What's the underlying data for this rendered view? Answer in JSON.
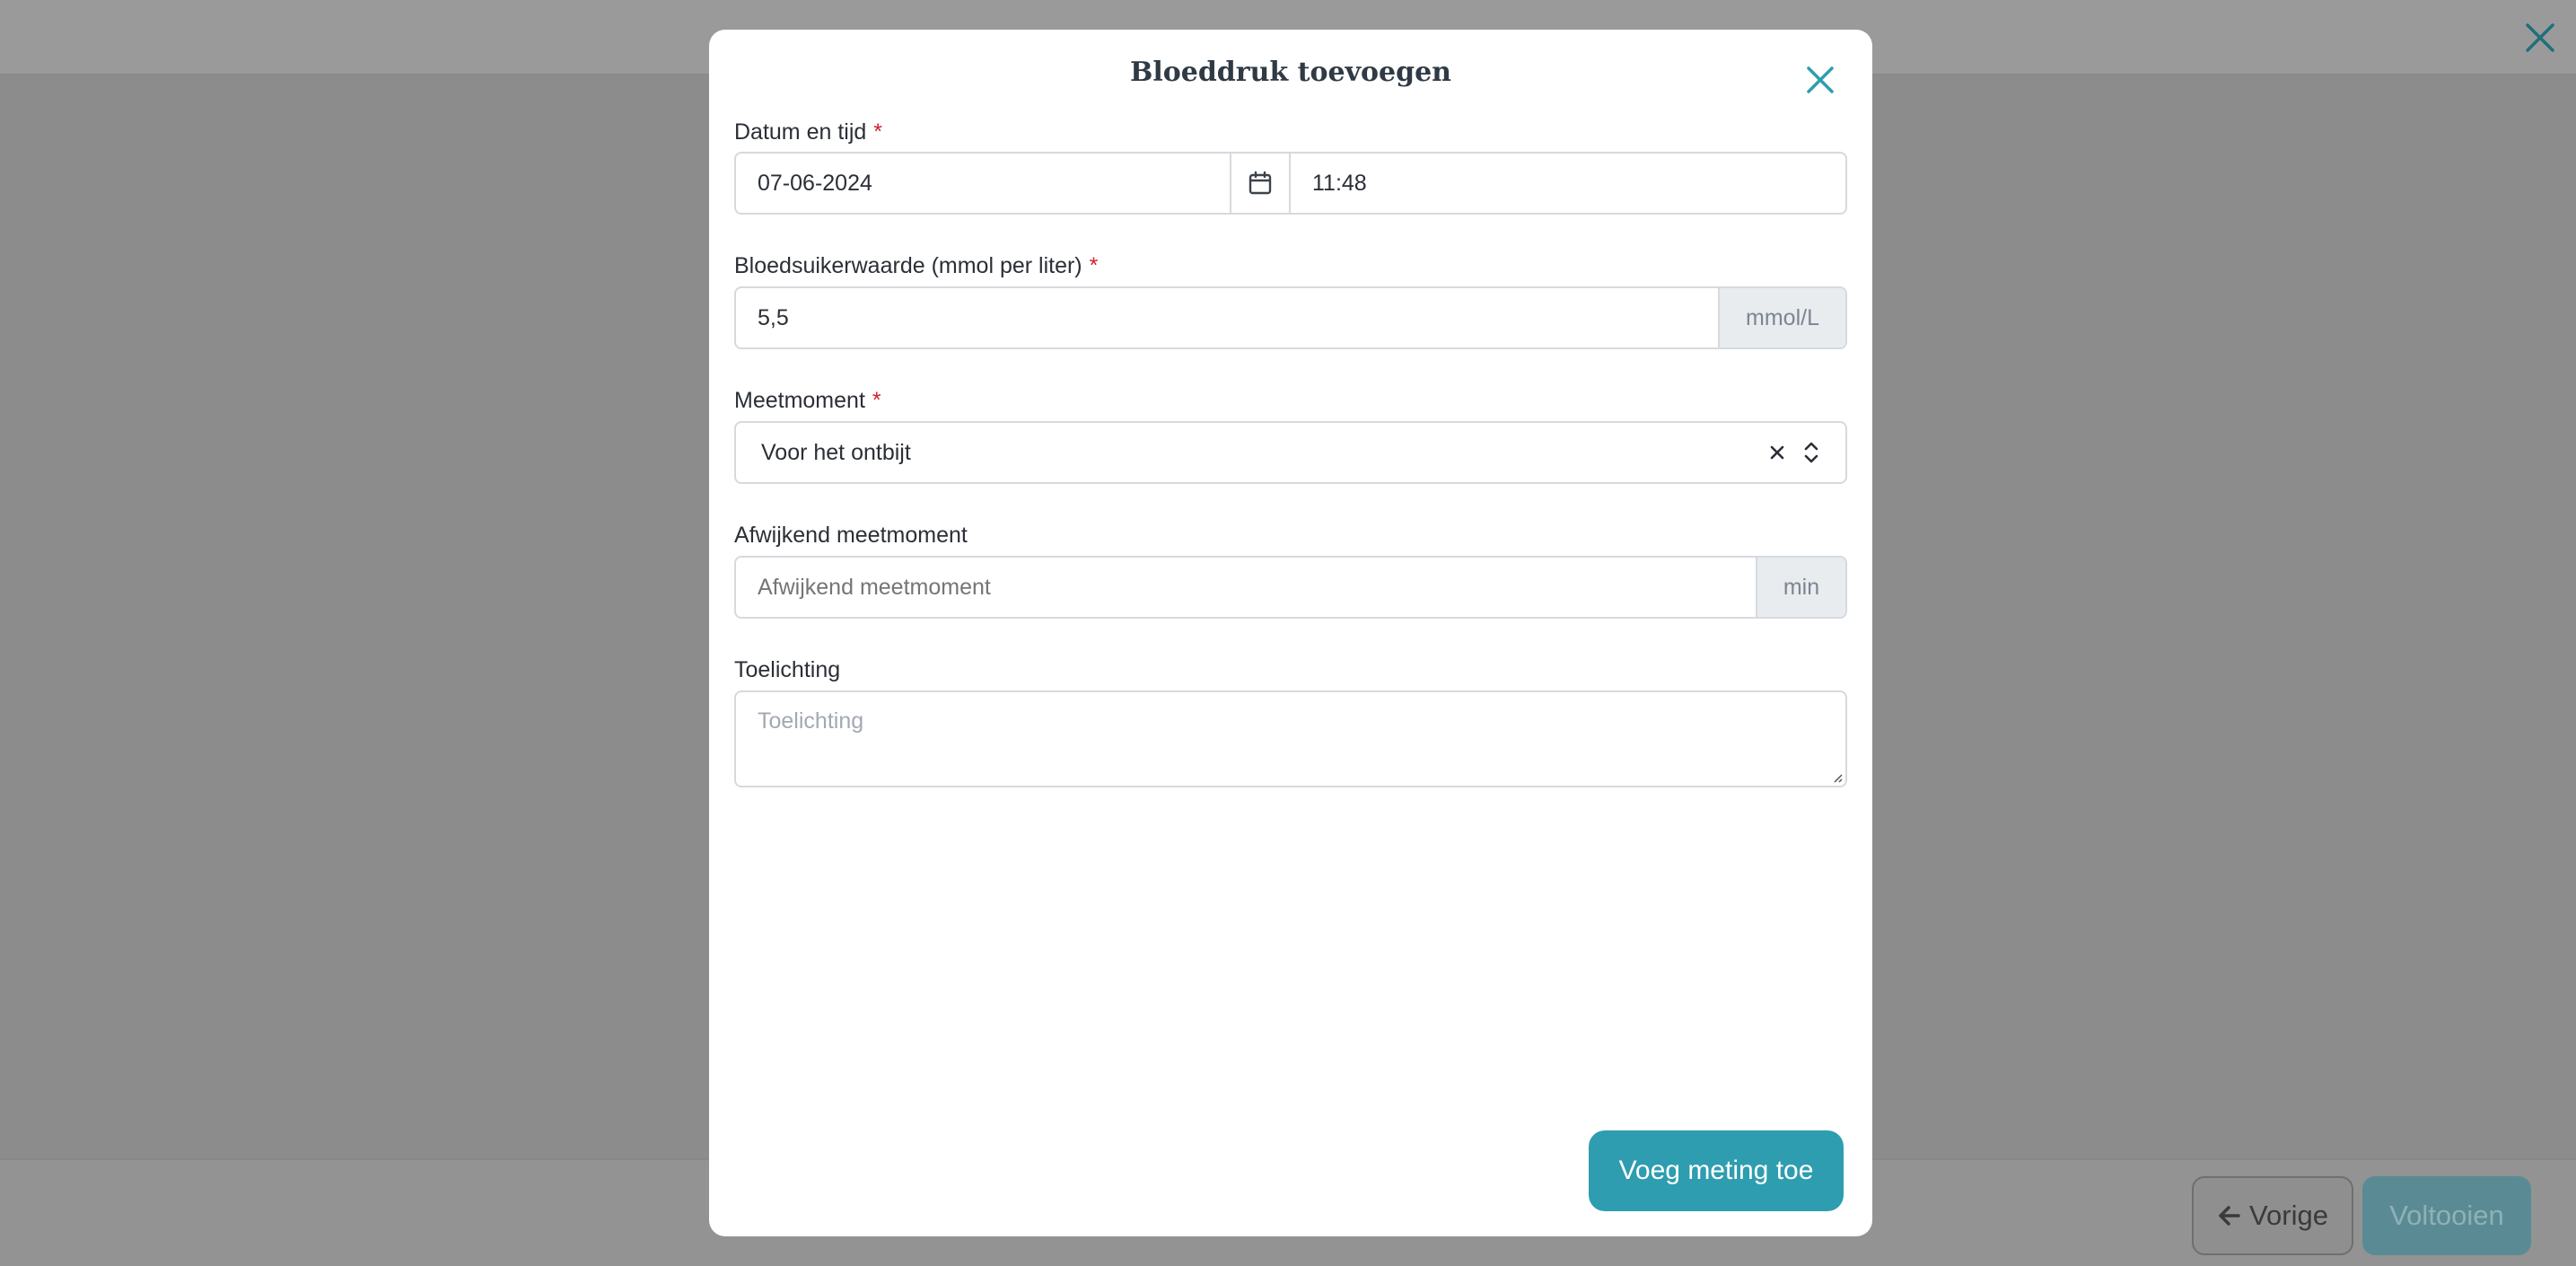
{
  "background": {
    "footer": {
      "prev_label": "Vorige",
      "done_label": "Voltooien"
    }
  },
  "modal": {
    "title": "Bloeddruk toevoegen",
    "datetime": {
      "label": "Datum en tijd",
      "required_mark": "*",
      "date_value": "07-06-2024",
      "time_value": "11:48"
    },
    "glucose": {
      "label": "Bloedsuikerwaarde (mmol per liter)",
      "required_mark": "*",
      "value": "5,5",
      "unit": "mmol/L"
    },
    "moment": {
      "label": "Meetmoment",
      "required_mark": "*",
      "selected": "Voor het ontbijt"
    },
    "deviating_moment": {
      "label": "Afwijkend meetmoment",
      "placeholder": "Afwijkend meetmoment",
      "unit": "min"
    },
    "note": {
      "label": "Toelichting",
      "placeholder": "Toelichting"
    },
    "submit_label": "Voeg meting toe"
  },
  "colors": {
    "accent": "#2f9db0",
    "required": "#d0202f",
    "overlay": "#8c8c8c"
  }
}
